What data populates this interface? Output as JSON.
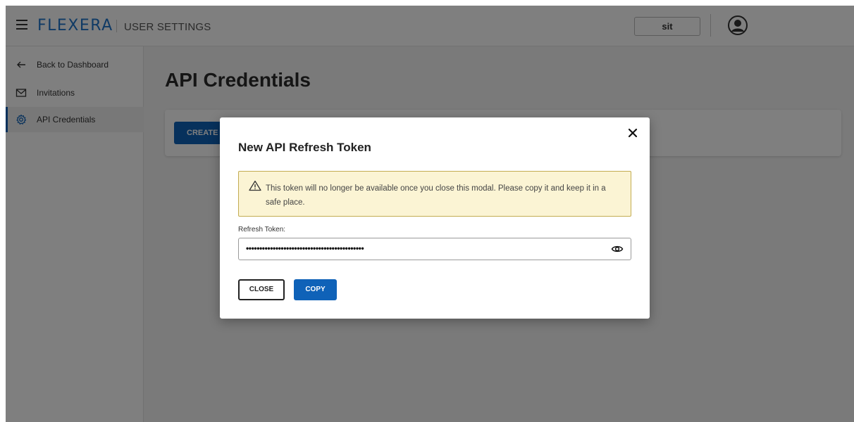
{
  "header": {
    "logo": "FLEXERA",
    "section": "USER SETTINGS",
    "org_selector": "sit"
  },
  "sidebar": {
    "items": [
      {
        "label": "Back to Dashboard",
        "icon": "arrow-left-icon"
      },
      {
        "label": "Invitations",
        "icon": "envelope-icon"
      },
      {
        "label": "API Credentials",
        "icon": "gear-icon",
        "active": true
      }
    ]
  },
  "main": {
    "title": "API Credentials",
    "create_button_label": "CREATE A"
  },
  "modal": {
    "title": "New API Refresh Token",
    "warning": "This token will no longer be available once you close this modal. Please copy it and keep it in a safe place.",
    "field_label": "Refresh Token:",
    "token_masked": "••••••••••••••••••••••••••••••••••••••••••••",
    "close_label": "CLOSE",
    "copy_label": "COPY"
  },
  "colors": {
    "brand": "#1f75cb",
    "primary_button": "#0f62b8",
    "warning_bg": "#fbf4d4",
    "warning_border": "#c3ac52"
  }
}
